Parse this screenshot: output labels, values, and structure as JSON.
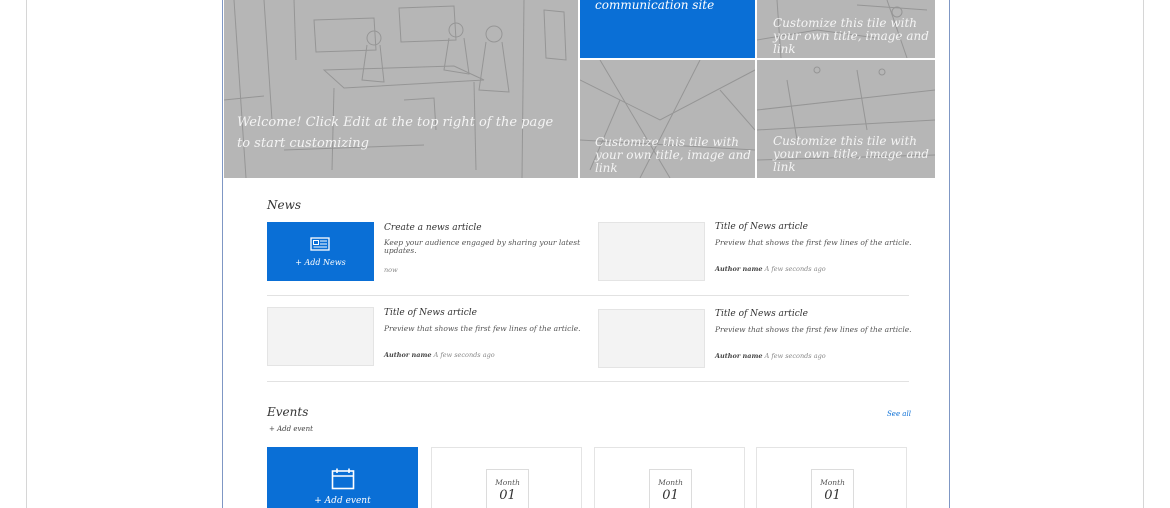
{
  "hero": {
    "main_tile_text": "Welcome! Click Edit at the top right of the page to start customizing",
    "blue_tile_text": "communication site",
    "tiles": [
      "Customize this tile with your own title, image and link",
      "Customize this tile with your own title, image and link",
      "Customize this tile with your own title, image and link"
    ]
  },
  "news": {
    "title": "News",
    "add_label": "+ Add News",
    "create": {
      "title": "Create a news article",
      "description": "Keep your audience engaged by sharing your latest updates.",
      "meta": "now"
    },
    "articles": [
      {
        "title": "Title of News article",
        "preview": "Preview that shows the first few lines of the article.",
        "author": "Author name",
        "time": "A few seconds ago"
      },
      {
        "title": "Title of News article",
        "preview": "Preview that shows the first few lines of the article.",
        "author": "Author name",
        "time": "A few seconds ago"
      },
      {
        "title": "Title of News article",
        "preview": "Preview that shows the first few lines of the article.",
        "author": "Author name",
        "time": "A few seconds ago"
      }
    ]
  },
  "events": {
    "title": "Events",
    "see_all": "See all",
    "add_event_link": "+ Add event",
    "add_event_tile": "+ Add event",
    "cards": [
      {
        "month": "Month",
        "day": "01"
      },
      {
        "month": "Month",
        "day": "01"
      },
      {
        "month": "Month",
        "day": "01"
      }
    ]
  },
  "colors": {
    "accent": "#0a6fd6",
    "page_border": "#7f97c4",
    "tile_gray": "#b6b6b6"
  }
}
